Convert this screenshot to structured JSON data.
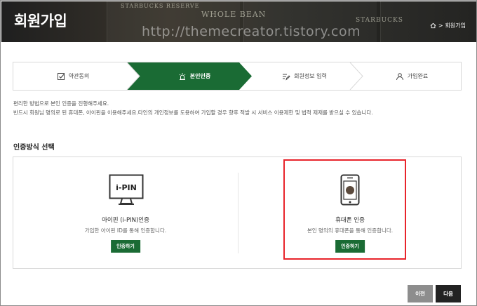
{
  "header": {
    "title": "회원가입",
    "watermark": "http://themecreator.tistory.com",
    "breadcrumb_current": "회원가입",
    "chalk_texts": [
      "WHOLE BEAN",
      "STARBUCKS RESERVE",
      "STARBUCKS"
    ]
  },
  "steps": [
    {
      "label": "약관동의",
      "icon": "checkbox-icon",
      "active": false
    },
    {
      "label": "본인인증",
      "icon": "alarm-light-icon",
      "active": true
    },
    {
      "label": "회원정보 입력",
      "icon": "edit-list-icon",
      "active": false
    },
    {
      "label": "가입완료",
      "icon": "user-icon",
      "active": false
    }
  ],
  "description": {
    "line1": "편리한 방법으로 본인 인증을 진행해주세요.",
    "line2": "반드시 회원님 명의로 된 휴대폰, 아이핀을 이용해주세요.타인의 개인정보를 도용하여 가입할 경우 향후 적발 시 서비스 이용제한 및 법적 제재를 받으실 수 있습니다."
  },
  "section_title": "인증방식 선택",
  "methods": [
    {
      "title": "아이핀 (i-PIN)인증",
      "desc": "가입한 아이핀 ID를 통해 인증합니다.",
      "button": "인증하기",
      "icon": "ipin-monitor-icon",
      "icon_text": "i-PIN"
    },
    {
      "title": "휴대폰 인증",
      "desc": "본인 명의의 휴대폰을 통해 인증합니다.",
      "button": "인증하기",
      "icon": "mobile-phone-icon"
    }
  ],
  "footer": {
    "prev": "이전",
    "next": "다음"
  },
  "colors": {
    "accent": "#1a6b34",
    "highlight": "#e8242b",
    "dark_button": "#222222",
    "gray_button": "#8d8d8d"
  }
}
